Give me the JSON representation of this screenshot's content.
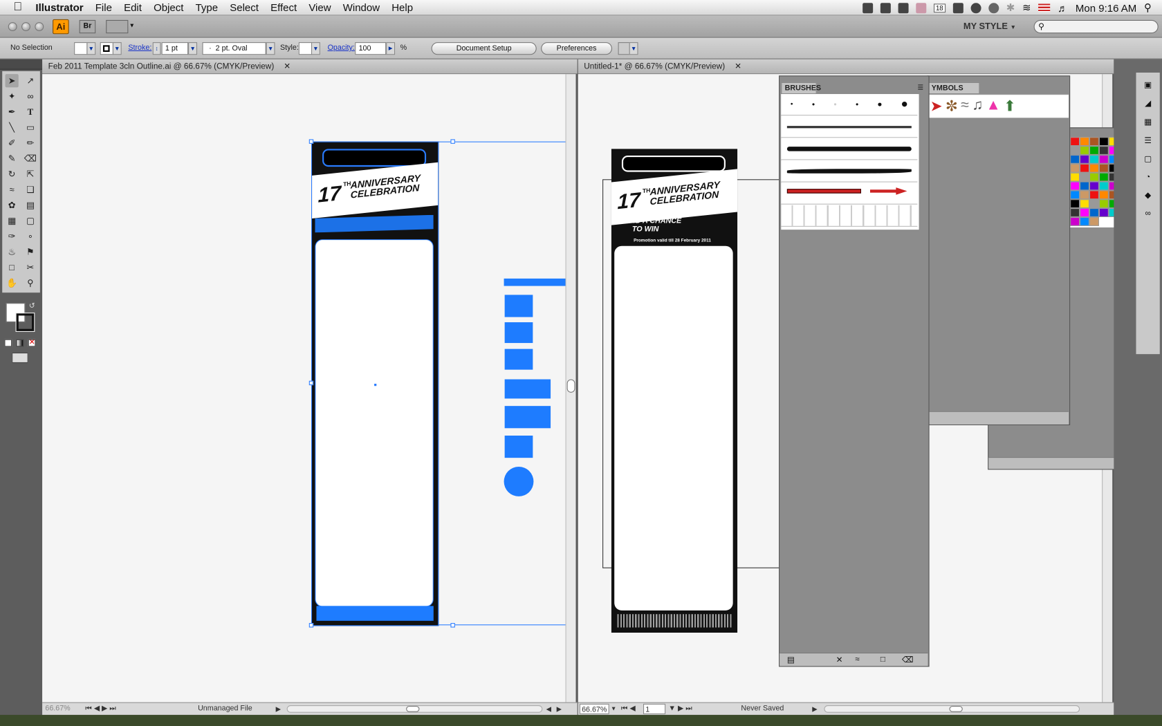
{
  "menubar": {
    "app_name": "Illustrator",
    "items": [
      "File",
      "Edit",
      "Object",
      "Type",
      "Select",
      "Effect",
      "View",
      "Window",
      "Help"
    ],
    "clock": "Mon 9:16 AM",
    "calendar_day": "18"
  },
  "appbar": {
    "app_logo": "Ai",
    "bridge_label": "Br",
    "workspace": "MY STYLE"
  },
  "control": {
    "selection": "No Selection",
    "stroke_label": "Stroke:",
    "stroke_weight": "1 pt",
    "brush": "2 pt. Oval",
    "style_label": "Style:",
    "opacity_label": "Opacity:",
    "opacity_value": "100",
    "opacity_unit": "%",
    "doc_setup": "Document Setup",
    "preferences": "Preferences"
  },
  "doc1": {
    "title": "Feb 2011 Template 3cln Outline.ai @ 66.67% (CMYK/Preview)",
    "zoom": "66.67%",
    "status": "Unmanaged File"
  },
  "doc2": {
    "title": "Untitled-1* @ 66.67% (CMYK/Preview)",
    "zoom": "66.67%",
    "page": "1",
    "status": "Never Saved"
  },
  "artwork": {
    "headline_num": "17",
    "headline_sup": "TH",
    "headline_line1": "ANNIVERSARY",
    "headline_line2": "CELEBRATION",
    "tagline1": "STAND A CHANCE",
    "tagline2": "TO WIN",
    "promo": "Promotion valid till 28 February 2011"
  },
  "panels": {
    "brushes_title": "BRUSHES",
    "symbols_title": "YMBOLS"
  },
  "colors": {
    "selection_blue": "#1e7cff",
    "ai_orange": "#ff9a00"
  }
}
